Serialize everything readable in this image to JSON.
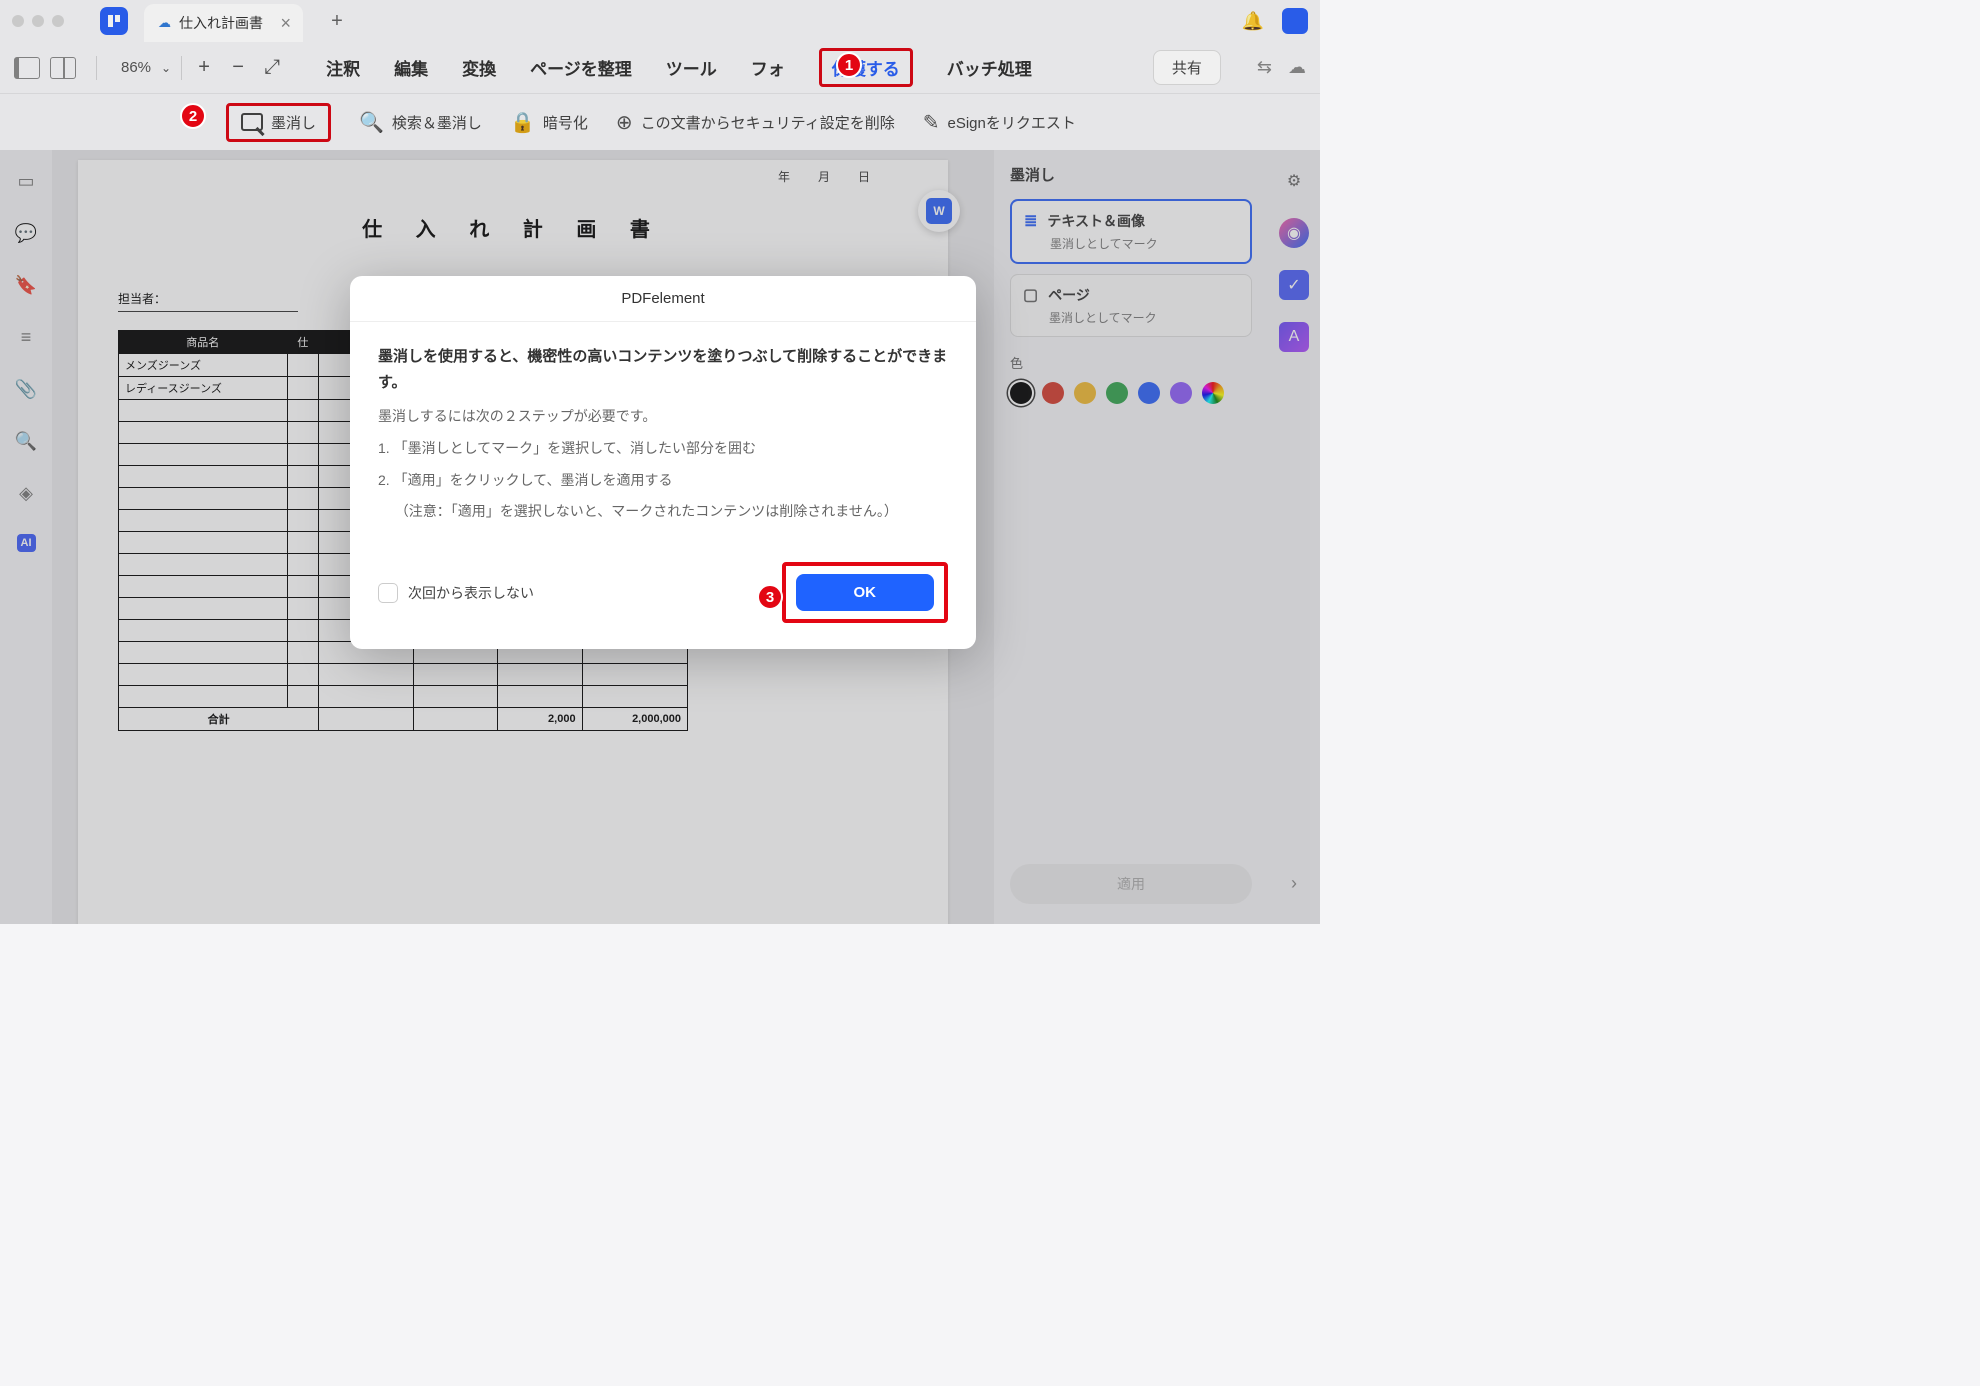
{
  "title_bar": {
    "tab_title": "仕入れ計画書"
  },
  "toolbar": {
    "zoom": "86%",
    "menu": {
      "annotate": "注釈",
      "edit": "編集",
      "convert": "変換",
      "organize": "ページを整理",
      "tools": "ツール",
      "form": "フォ",
      "protect": "保護する",
      "batch": "バッチ処理"
    },
    "share": "共有"
  },
  "protect_bar": {
    "redact": "墨消し",
    "search_redact": "検索＆墨消し",
    "encrypt": "暗号化",
    "remove_security": "この文書からセキュリティ設定を削除",
    "esign": "eSignをリクエスト"
  },
  "document": {
    "title": "仕 入 れ 計 画 書",
    "date_labels": "年　月　日",
    "staff_label": "担当者：",
    "headers": {
      "name": "商品名",
      "qty_prefix": "仕"
    },
    "rows": [
      "メンズジーンズ",
      "レディースジーンズ"
    ],
    "footer": {
      "label": "合計",
      "col1": "2,000",
      "col2": "2,000,000"
    }
  },
  "right_panel": {
    "title": "墨消し",
    "card_text_image": {
      "title": "テキスト＆画像",
      "sub": "墨消しとしてマーク"
    },
    "card_page": {
      "title": "ページ",
      "sub": "墨消しとしてマーク"
    },
    "color_label": "色",
    "apply": "適用"
  },
  "modal": {
    "title": "PDFelement",
    "heading": "墨消しを使用すると、機密性の高いコンテンツを塗りつぶして削除することができます。",
    "intro": "墨消しするには次の２ステップが必要です。",
    "step1": "1. 「墨消しとしてマーク」を選択して、消したい部分を囲む",
    "step2a": "2. 「適用」をクリックして、墨消しを適用する",
    "step2b": "（注意：「適用」を選択しないと、マークされたコンテンツは削除されません。）",
    "dont_show": "次回から表示しない",
    "ok": "OK"
  },
  "colors": [
    "#000000",
    "#d93a2b",
    "#f2b92b",
    "#2ea44a",
    "#2962ff",
    "#8e5cff",
    "conic-gradient(red,orange,yellow,green,cyan,blue,magenta,red)"
  ],
  "badges": {
    "b1": "1",
    "b2": "2",
    "b3": "3"
  }
}
